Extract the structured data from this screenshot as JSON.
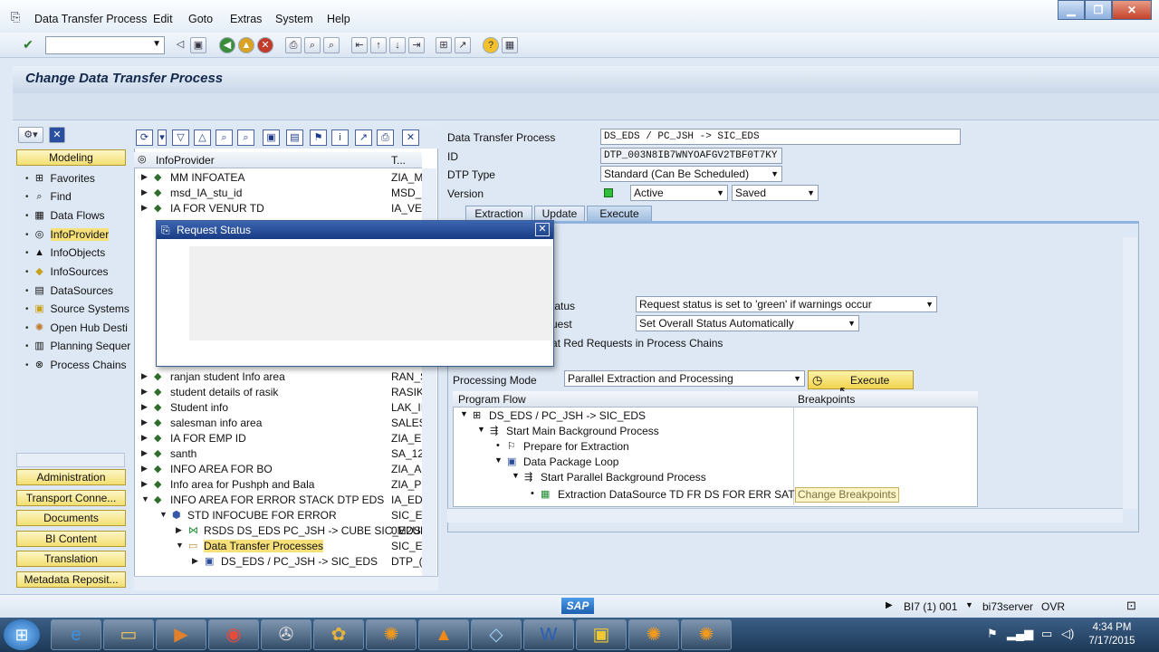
{
  "menu": [
    "Data Transfer Process",
    "Edit",
    "Goto",
    "Extras",
    "System",
    "Help"
  ],
  "page_title": "Change Data Transfer Process",
  "nav": {
    "top_button": "Modeling",
    "items": [
      "Favorites",
      "Find",
      "Data Flows",
      "InfoProvider",
      "InfoObjects",
      "InfoSources",
      "DataSources",
      "Source Systems",
      "Open Hub Desti",
      "Planning Sequer",
      "Process Chains"
    ],
    "bottom_buttons": [
      "Administration",
      "Transport Conne...",
      "Documents",
      "BI Content",
      "Translation",
      "Metadata Reposit..."
    ]
  },
  "tree": {
    "col1": "InfoProvider",
    "col2": "T...",
    "rows": [
      {
        "label": "MM INFOATEA",
        "tech": "ZIA_M"
      },
      {
        "label": "msd_IA_stu_id",
        "tech": "MSD_I"
      },
      {
        "label": "IA FOR VENUR TD",
        "tech": "IA_VE"
      },
      {
        "label": "ranjan student Info area",
        "tech": "RAN_S"
      },
      {
        "label": "student details of rasik",
        "tech": "RASIK"
      },
      {
        "label": "Student info",
        "tech": "LAK_II"
      },
      {
        "label": "salesman info area",
        "tech": "SALES"
      },
      {
        "label": "IA FOR EMP ID",
        "tech": "ZIA_E"
      },
      {
        "label": "santh",
        "tech": "SA_12"
      },
      {
        "label": "INFO AREA FOR BO",
        "tech": "ZIA_A"
      },
      {
        "label": "Info area for Pushph and Bala",
        "tech": "ZIA_P"
      },
      {
        "label": "INFO AREA FOR ERROR STACK DTP EDS",
        "tech": "IA_ED"
      },
      {
        "label": "STD INFOCUBE FOR ERROR",
        "tech": "SIC_EI"
      },
      {
        "label": "RSDS DS_EDS PC_JSH -> CUBE SIC_EDS",
        "tech": "0M2UH"
      },
      {
        "label": "Data Transfer Processes",
        "tech": "SIC_EI"
      },
      {
        "label": "DS_EDS / PC_JSH -> SIC_EDS",
        "tech": "DTP_("
      }
    ]
  },
  "form": {
    "dtp_label": "Data Transfer Process",
    "dtp_value": "DS_EDS / PC_JSH -> SIC_EDS",
    "id_label": "ID",
    "id_value": "DTP_003N8IB7WNYOAFGV2TBF0T7KY",
    "type_label": "DTP Type",
    "type_value": "Standard (Can Be Scheduled)",
    "version_label": "Version",
    "version_value": "Active",
    "saved_value": "Saved",
    "tabs": [
      "Extraction",
      "Update",
      "Execute"
    ],
    "status_label_partial": "tatus",
    "status_value": "Request status is set to 'green' if warnings occur",
    "request_label_partial": "uest",
    "request_value": "Set Overall Status Automatically",
    "redreq_partial": "at Red Requests in Process Chains",
    "proc_mode_label": "Processing Mode",
    "proc_mode_value": "Parallel Extraction and Processing",
    "execute_label": "Execute",
    "pf_col1": "Program Flow",
    "pf_col2": "Breakpoints",
    "pf_rows": [
      "DS_EDS / PC_JSH -> SIC_EDS",
      "Start Main Background Process",
      "Prepare for Extraction",
      "Data Package Loop",
      "Start Parallel Background Process",
      "Extraction DataSource TD FR DS FOR ERR SATCK"
    ],
    "change_bp": "Change Breakpoints"
  },
  "dialog": {
    "title": "Request Status"
  },
  "status": {
    "sap": "SAP",
    "system": "BI7 (1) 001",
    "server": "bi73server",
    "mode": "OVR"
  },
  "clock": {
    "time": "4:34 PM",
    "date": "7/17/2015"
  }
}
